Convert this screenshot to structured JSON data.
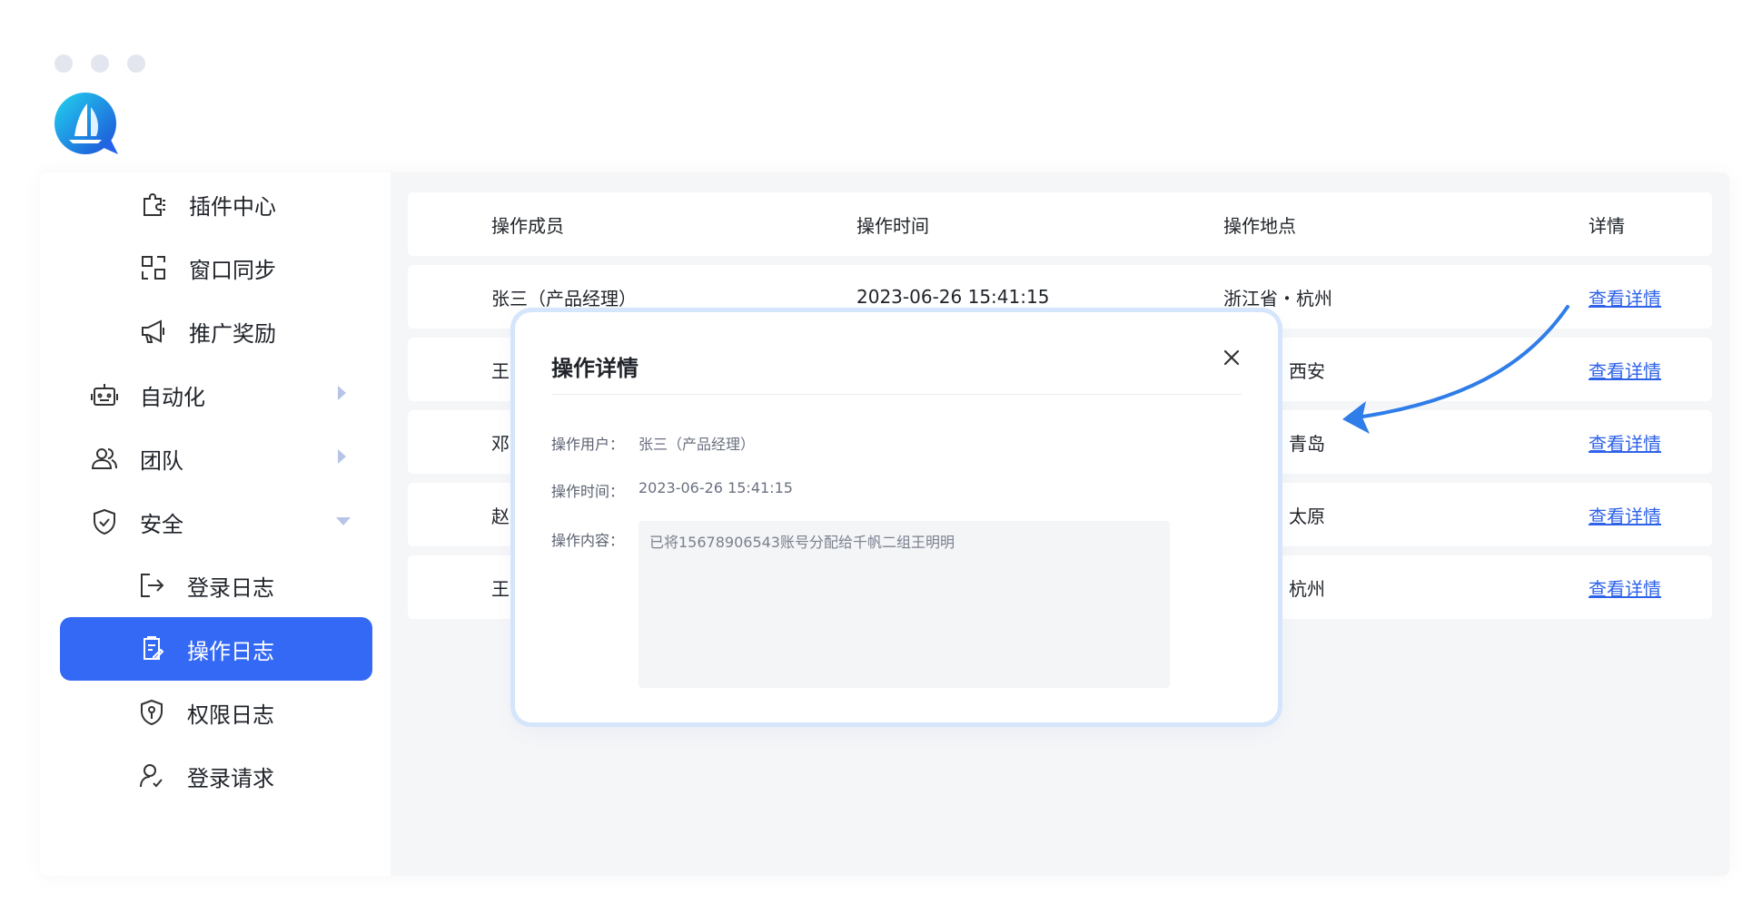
{
  "colors": {
    "accent": "#3469f5",
    "link": "#2e62e8",
    "caret": "#b7c4e8",
    "arrow": "#2f7de8"
  },
  "sidebar": {
    "items": [
      {
        "label": "插件中心",
        "icon": "puzzle-icon"
      },
      {
        "label": "窗口同步",
        "icon": "window-sync-icon"
      },
      {
        "label": "推广奖励",
        "icon": "megaphone-icon"
      },
      {
        "label": "自动化",
        "icon": "robot-icon"
      },
      {
        "label": "团队",
        "icon": "team-icon"
      },
      {
        "label": "安全",
        "icon": "shield-icon"
      },
      {
        "label": "登录日志",
        "icon": "logout-icon"
      },
      {
        "label": "操作日志",
        "icon": "document-edit-icon"
      },
      {
        "label": "权限日志",
        "icon": "key-shield-icon"
      },
      {
        "label": "登录请求",
        "icon": "user-check-icon"
      }
    ]
  },
  "table": {
    "headers": [
      "操作成员",
      "操作时间",
      "操作地点",
      "详情"
    ],
    "rows": [
      {
        "member": "张三（产品经理）",
        "time": "2023-06-26  15:41:15",
        "location": "浙江省・杭州",
        "detail": "查看详情"
      },
      {
        "member": "王",
        "time": "",
        "location": "・西安",
        "detail": "查看详情"
      },
      {
        "member": "邓",
        "time": "",
        "location": "・青岛",
        "detail": "查看详情"
      },
      {
        "member": "赵",
        "time": "",
        "location": "・太原",
        "detail": "查看详情"
      },
      {
        "member": "王",
        "time": "",
        "location": "・杭州",
        "detail": "查看详情"
      }
    ]
  },
  "modal": {
    "title": "操作详情",
    "user_label": "操作用户：",
    "user_value": "张三（产品经理）",
    "time_label": "操作时间：",
    "time_value": "2023-06-26  15:41:15",
    "content_label": "操作内容：",
    "content_value": "已将15678906543账号分配给千帆二组王明明"
  }
}
